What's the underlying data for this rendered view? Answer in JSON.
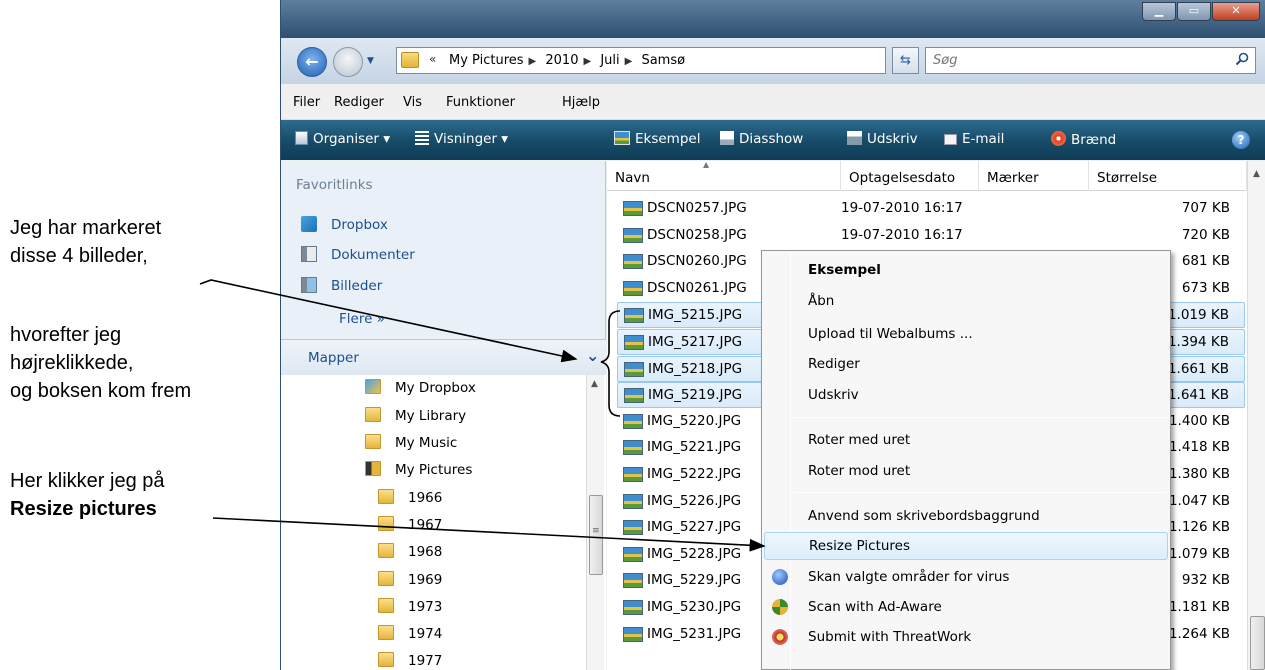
{
  "annotations": {
    "a1_line1": "Jeg har markeret",
    "a1_line2": "disse 4 billeder,",
    "a2_line1": "hvorefter jeg",
    "a2_line2": "højreklikkede,",
    "a2_line3": "og boksen kom frem",
    "a3_line1": "Her klikker jeg på",
    "a3_line2": "Resize pictures"
  },
  "address": {
    "chevrons": "«",
    "crumbs": [
      "My Pictures",
      "2010",
      "Juli",
      "Samsø"
    ],
    "search_placeholder": "Søg"
  },
  "menubar": [
    "Filer",
    "Rediger",
    "Vis",
    "Funktioner",
    "Hjælp"
  ],
  "toolbar": {
    "organise": "Organiser ▾",
    "views": "Visninger ▾",
    "preview": "Eksempel",
    "slideshow": "Diasshow",
    "print": "Udskriv",
    "email": "E-mail",
    "burn": "Brænd",
    "help": "?"
  },
  "navpane": {
    "favorites_header": "Favoritlinks",
    "favorites": [
      "Dropbox",
      "Dokumenter",
      "Billeder"
    ],
    "more": "Flere  »",
    "folders_header": "Mapper",
    "tree": [
      "My Dropbox",
      "My Library",
      "My Music",
      "My Pictures",
      "1966",
      "1967",
      "1968",
      "1969",
      "1973",
      "1974",
      "1977"
    ]
  },
  "columns": {
    "name": "Navn",
    "date": "Optagelsesdato",
    "tags": "Mærker",
    "size": "Størrelse"
  },
  "files": [
    {
      "name": "DSCN0257.JPG",
      "date": "19-07-2010 16:17",
      "size": "707 KB",
      "selected": false
    },
    {
      "name": "DSCN0258.JPG",
      "date": "19-07-2010 16:17",
      "size": "720 KB",
      "selected": false
    },
    {
      "name": "DSCN0260.JPG",
      "date": "",
      "size": "681 KB",
      "selected": false
    },
    {
      "name": "DSCN0261.JPG",
      "date": "",
      "size": "673 KB",
      "selected": false
    },
    {
      "name": "IMG_5215.JPG",
      "date": "",
      "size": "1.019 KB",
      "selected": true
    },
    {
      "name": "IMG_5217.JPG",
      "date": "",
      "size": "1.394 KB",
      "selected": true
    },
    {
      "name": "IMG_5218.JPG",
      "date": "",
      "size": "1.661 KB",
      "selected": true
    },
    {
      "name": "IMG_5219.JPG",
      "date": "",
      "size": "1.641 KB",
      "selected": true
    },
    {
      "name": "IMG_5220.JPG",
      "date": "",
      "size": "1.400 KB",
      "selected": false
    },
    {
      "name": "IMG_5221.JPG",
      "date": "",
      "size": "1.418 KB",
      "selected": false
    },
    {
      "name": "IMG_5222.JPG",
      "date": "",
      "size": "1.380 KB",
      "selected": false
    },
    {
      "name": "IMG_5226.JPG",
      "date": "",
      "size": "1.047 KB",
      "selected": false
    },
    {
      "name": "IMG_5227.JPG",
      "date": "",
      "size": "1.126 KB",
      "selected": false
    },
    {
      "name": "IMG_5228.JPG",
      "date": "",
      "size": "1.079 KB",
      "selected": false
    },
    {
      "name": "IMG_5229.JPG",
      "date": "",
      "size": "932 KB",
      "selected": false
    },
    {
      "name": "IMG_5230.JPG",
      "date": "",
      "size": "1.181 KB",
      "selected": false
    },
    {
      "name": "IMG_5231.JPG",
      "date": "",
      "size": "1.264 KB",
      "selected": false
    }
  ],
  "context_menu": {
    "preview": "Eksempel",
    "open": "Åbn",
    "upload": "Upload til Webalbums ...",
    "edit": "Rediger",
    "print": "Udskriv",
    "rotate_cw": "Roter med uret",
    "rotate_ccw": "Roter mod uret",
    "wallpaper": "Anvend som skrivebordsbaggrund",
    "resize": "Resize Pictures",
    "scan_virus": "Skan valgte områder for virus",
    "adaware": "Scan with Ad-Aware",
    "threatwork": "Submit with ThreatWork"
  },
  "colors": {
    "toolbar": "#164a66",
    "link": "#1b4f8f",
    "selection": "#d9ebfb",
    "selection_border": "#99c9ef"
  }
}
